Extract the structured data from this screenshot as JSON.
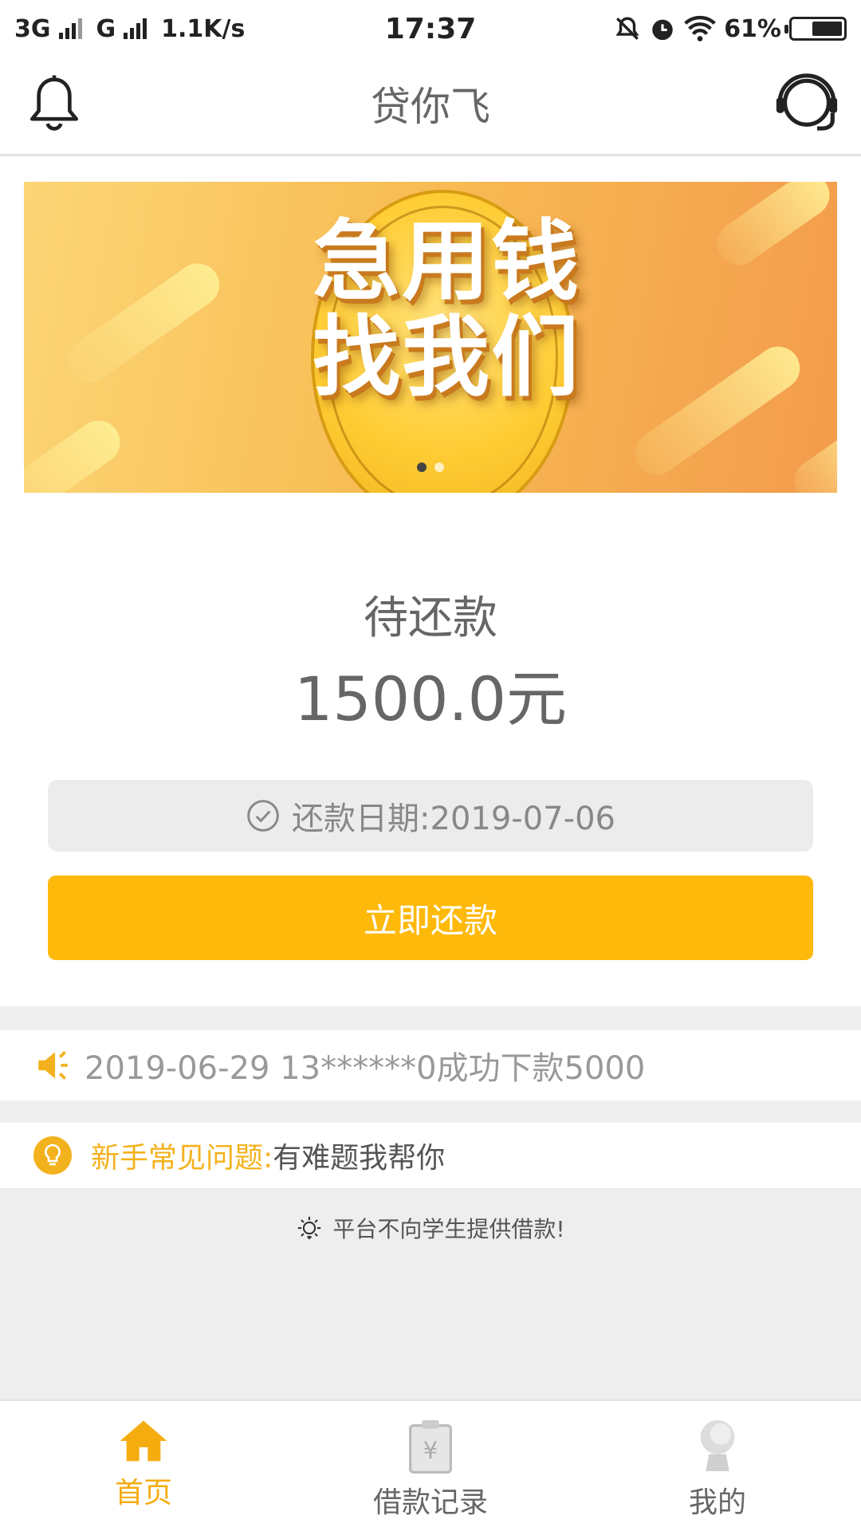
{
  "status_bar": {
    "network1": "3G",
    "network2": "G",
    "speed": "1.1K/s",
    "time": "17:37",
    "battery": "61%",
    "battery_level": 0.61
  },
  "header": {
    "title": "贷你飞"
  },
  "banner": {
    "line1": "急用钱",
    "line2": "找我们",
    "slide_count": 2,
    "active_slide": 0
  },
  "repayment": {
    "label": "待还款",
    "amount": "1500.0元",
    "due_date": "还款日期:2019-07-06",
    "button_label": "立即还款"
  },
  "notice": {
    "text": "2019-06-29 13******0成功下款5000"
  },
  "faq": {
    "highlight": "新手常见问题:",
    "text": "有难题我帮你"
  },
  "tip": {
    "text": "平台不向学生提供借款!"
  },
  "tabs": [
    {
      "label": "首页",
      "icon": "home-icon",
      "active": true
    },
    {
      "label": "借款记录",
      "icon": "loan-record-icon",
      "active": false
    },
    {
      "label": "我的",
      "icon": "profile-icon",
      "active": false
    }
  ],
  "colors": {
    "accent": "#ffb90a",
    "tab_active": "#f5ac0f",
    "faq_highlight": "#f3b21d"
  }
}
